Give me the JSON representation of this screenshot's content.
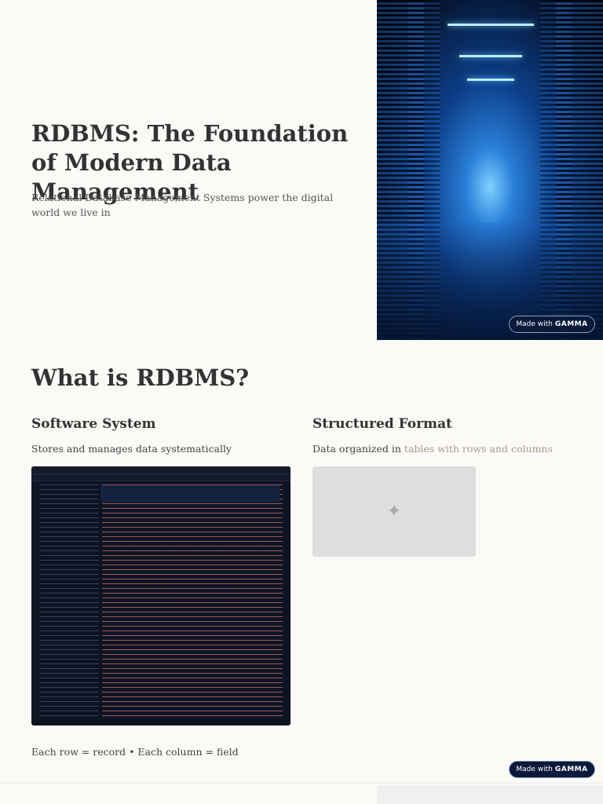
{
  "hero": {
    "title": "RDBMS: The Foundation of Modern Data Management",
    "subtitle": "Relational Database Management Systems power the digital world we live in"
  },
  "badge": {
    "prefix": "Made with",
    "brand": "GAMMA"
  },
  "section": {
    "title": "What is RDBMS?",
    "columns": [
      {
        "heading": "Software System",
        "text": "Stores and manages data systematically"
      },
      {
        "heading": "Structured Format",
        "text_plain": "Data organized in ",
        "text_highlight": "tables with rows and columns"
      }
    ],
    "footer": "Each row = record • Each column = field"
  }
}
